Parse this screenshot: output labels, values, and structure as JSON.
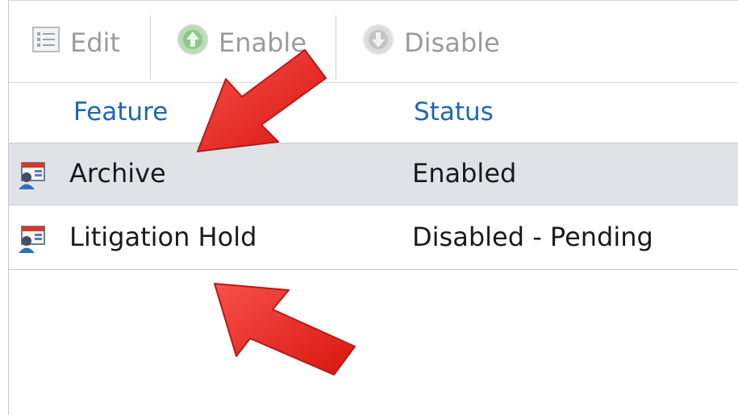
{
  "toolbar": {
    "edit_label": "Edit",
    "enable_label": "Enable",
    "disable_label": "Disable"
  },
  "table": {
    "columns": [
      "Feature",
      "Status"
    ],
    "rows": [
      {
        "feature": "Archive",
        "status": "Enabled",
        "selected": true
      },
      {
        "feature": "Litigation Hold",
        "status": "Disabled - Pending",
        "selected": false
      }
    ]
  },
  "icons": {
    "edit": "list-edit-icon",
    "enable": "green-up-arrow-icon",
    "disable": "gray-down-arrow-icon",
    "row": "mailbox-user-icon",
    "annotation": "red-arrow-icon"
  },
  "colors": {
    "header_text": "#1f66b6",
    "selected_row": "#dfe3e8",
    "toolbar_text": "#9b9b9b",
    "annotation_arrow": "#e8231d"
  }
}
